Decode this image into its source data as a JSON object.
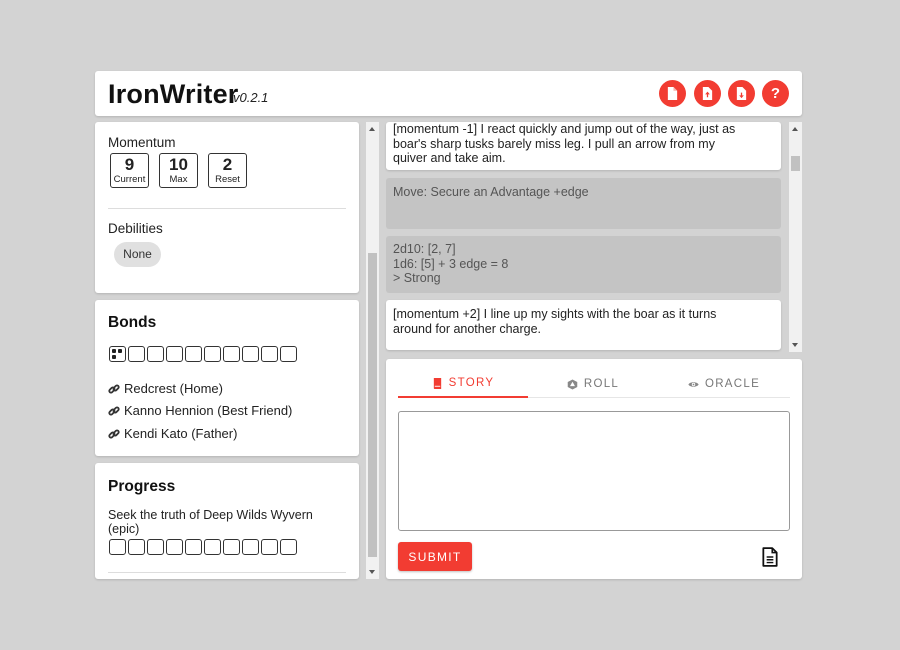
{
  "header": {
    "title": "IronWriter",
    "version": "v0.2.1",
    "buttons": [
      {
        "icon": "new-file-icon"
      },
      {
        "icon": "upload-file-icon"
      },
      {
        "icon": "download-file-icon"
      },
      {
        "icon": "help-icon",
        "label": "?"
      }
    ]
  },
  "momentum": {
    "label": "Momentum",
    "stats": [
      {
        "value": "9",
        "caption": "Current"
      },
      {
        "value": "10",
        "caption": "Max"
      },
      {
        "value": "2",
        "caption": "Reset"
      }
    ]
  },
  "debilities": {
    "label": "Debilities",
    "chip": "None"
  },
  "bonds": {
    "title": "Bonds",
    "ticks_filled": 1,
    "ticks_total": 10,
    "items": [
      "Redcrest (Home)",
      "Kanno Hennion (Best Friend)",
      "Kendi Kato (Father)"
    ]
  },
  "progress": {
    "title": "Progress",
    "track_name": "Seek the truth of Deep Wilds Wyvern",
    "track_rank": "(epic)",
    "ticks_filled": 0,
    "ticks_total": 10
  },
  "log": {
    "entry1_line1": "[momentum -1] I react quickly and jump out of the way, just as",
    "entry1_line2": "boar's sharp tusks barely miss leg. I pull an arrow from my",
    "entry1_line3": "quiver and take aim.",
    "move": "Move: Secure an Advantage +edge",
    "roll_line1": "2d10: [2, 7]",
    "roll_line2": "1d6: [5] + 3 edge = 8",
    "roll_line3": "> Strong",
    "entry2_line1": "[momentum +2] I line up my sights with the boar as it turns",
    "entry2_line2": "around for another charge."
  },
  "tabs": [
    {
      "label": "STORY",
      "icon": "book-icon",
      "active": true
    },
    {
      "label": "ROLL",
      "icon": "dice-icon",
      "active": false
    },
    {
      "label": "ORACLE",
      "icon": "eye-icon",
      "active": false
    }
  ],
  "input": {
    "value": "",
    "placeholder": ""
  },
  "submit_label": "SUBMIT",
  "accent_color": "#f23c32"
}
